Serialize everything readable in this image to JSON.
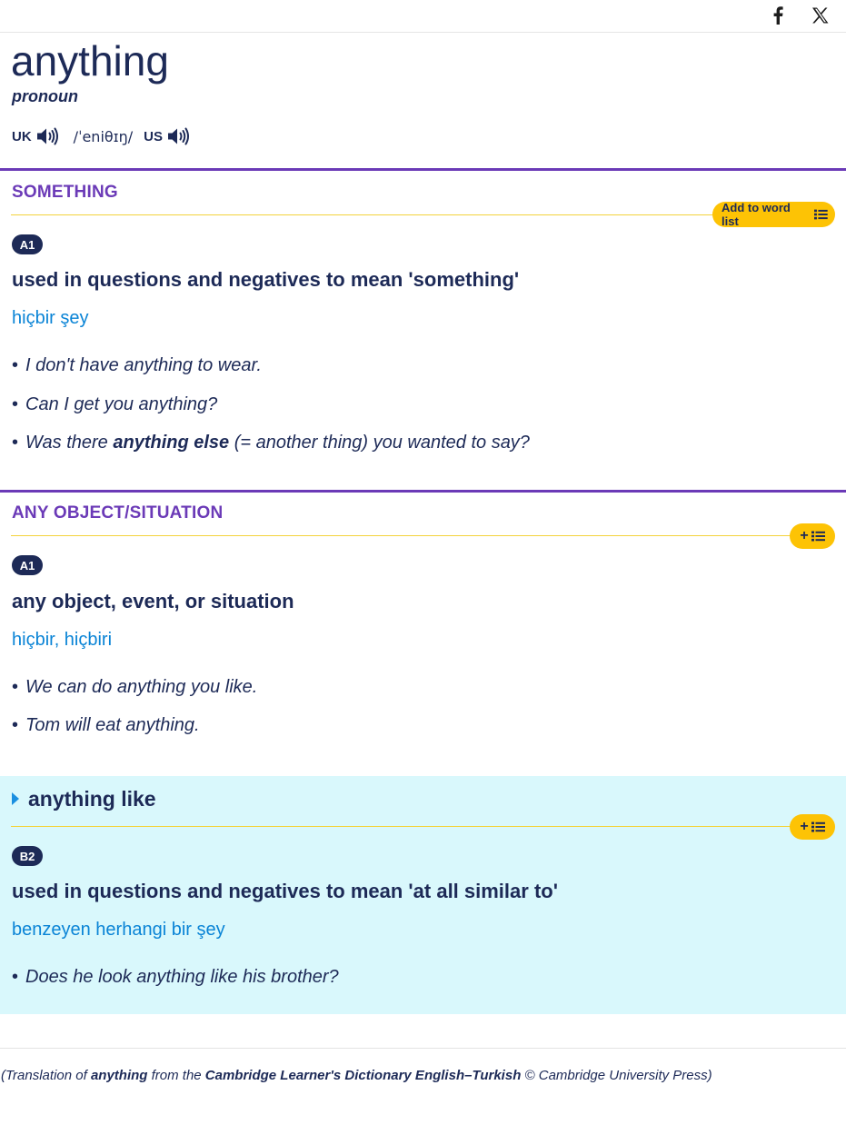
{
  "share": {
    "facebook_icon": "facebook-icon",
    "x_icon": "x-twitter-icon"
  },
  "entry": {
    "headword": "anything",
    "pos": "pronoun",
    "uk_label": "UK",
    "us_label": "US",
    "ipa": "/ˈeniθɪŋ/"
  },
  "senses": [
    {
      "guide": "SOMETHING",
      "add_button_label": "Add to word list",
      "level": "A1",
      "definition": "used in questions and negatives to mean 'something'",
      "translation": "hiçbir şey",
      "examples": [
        {
          "text": "I don't have anything to wear."
        },
        {
          "text": "Can I get you anything?"
        },
        {
          "pre": "Was there ",
          "bold": "anything else",
          "post": " (= another thing) you wanted to say?"
        }
      ]
    },
    {
      "guide": "ANY OBJECT/SITUATION",
      "add_button_label": "+",
      "level": "A1",
      "definition": "any object, event, or situation",
      "translation": "hiçbir, hiçbiri",
      "examples": [
        {
          "text": "We can do anything you like."
        },
        {
          "text": "Tom will eat anything."
        }
      ]
    }
  ],
  "idiom": {
    "title": "anything like",
    "add_button_label": "+",
    "level": "B2",
    "definition": "used in questions and negatives to mean 'at all similar to'",
    "translation": "benzeyen herhangi bir şey",
    "examples": [
      {
        "text": "Does he look anything like his brother?"
      }
    ]
  },
  "footer": {
    "open": "(Translation of ",
    "word": "anything",
    "mid": " from the ",
    "source": "Cambridge Learner's Dictionary English–Turkish",
    "close": " © Cambridge University Press)"
  },
  "colors": {
    "navy": "#1d2a57",
    "purple": "#6b3ab7",
    "yellow": "#fdc305",
    "translation_blue": "#0a84d6",
    "idiom_bg": "#d9f8fc"
  }
}
